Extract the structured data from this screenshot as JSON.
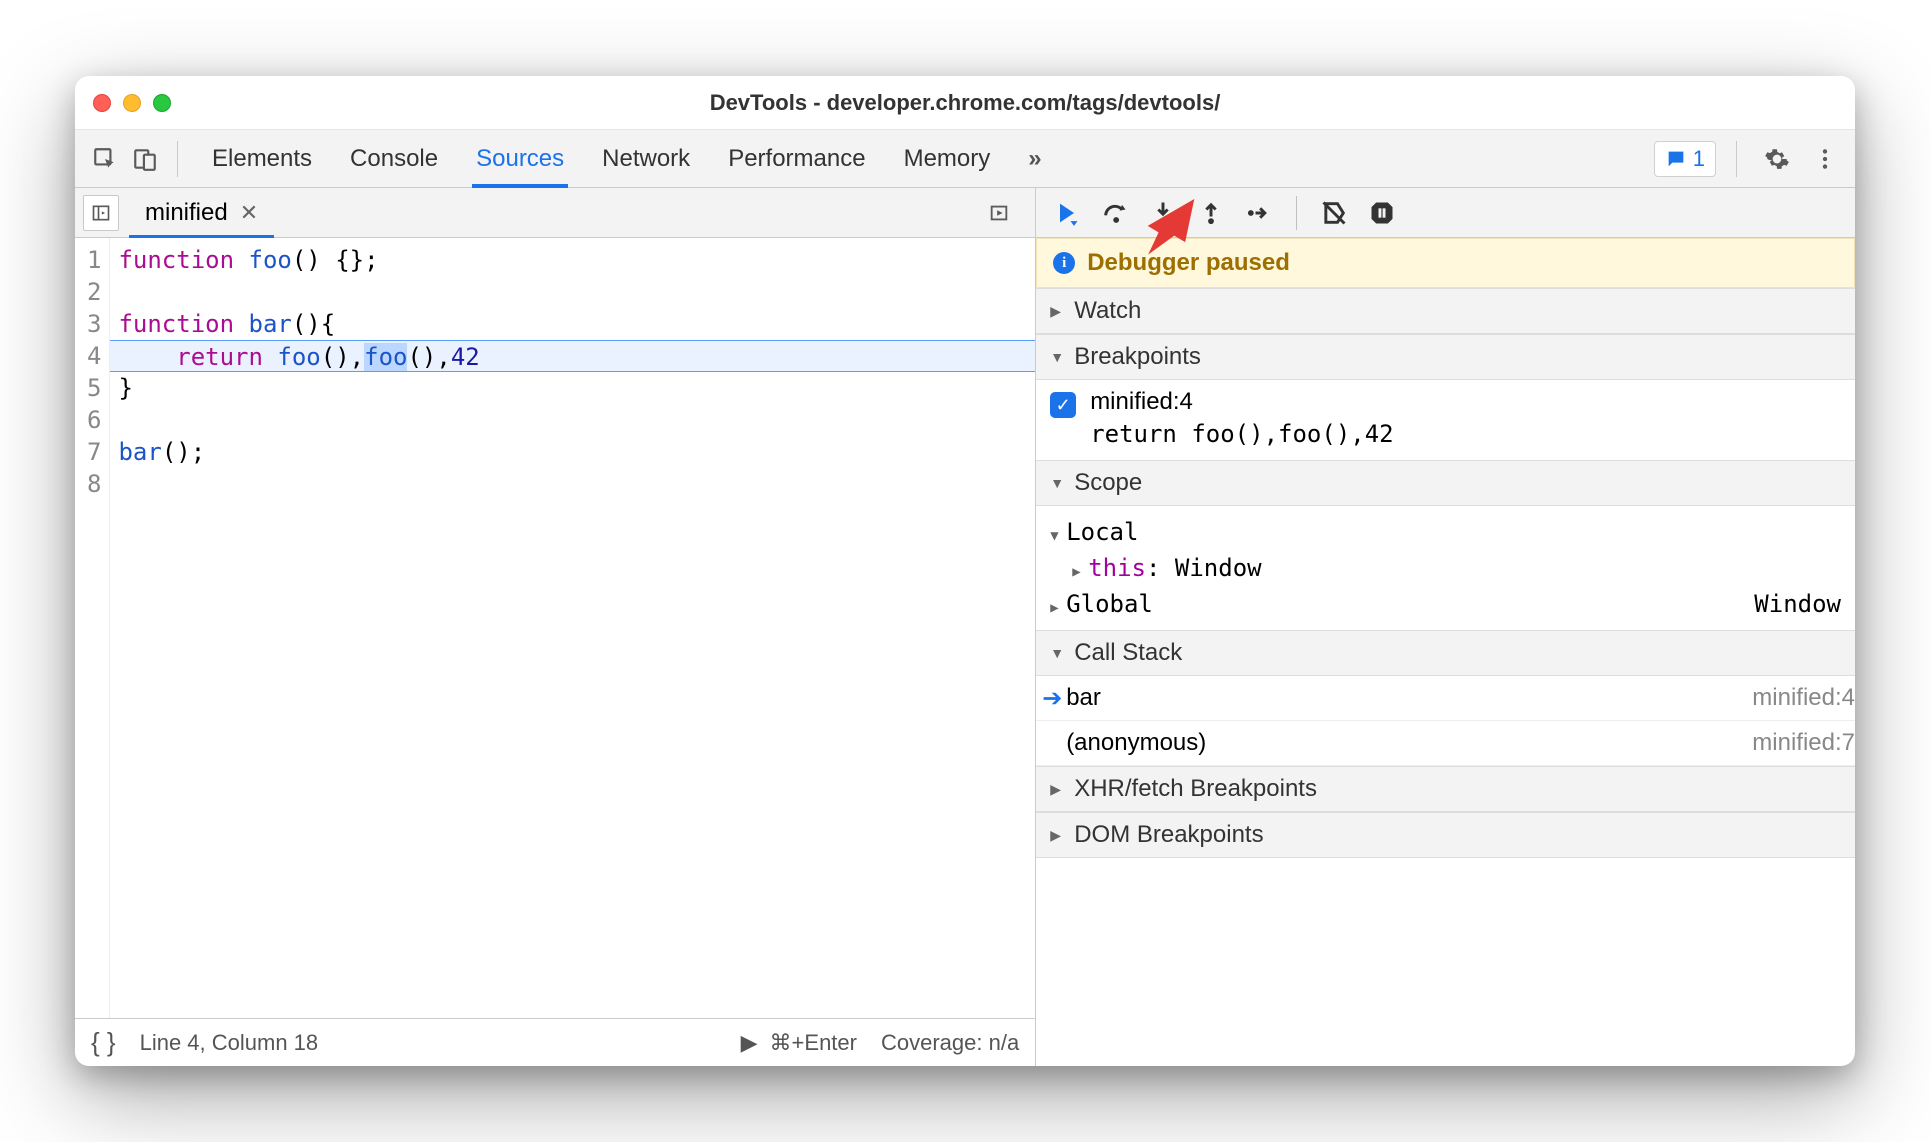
{
  "window": {
    "title": "DevTools - developer.chrome.com/tags/devtools/"
  },
  "top_tabs": {
    "items": [
      "Elements",
      "Console",
      "Sources",
      "Network",
      "Performance",
      "Memory"
    ],
    "active": "Sources",
    "overflow_glyph": "»"
  },
  "issues_badge": {
    "count": "1"
  },
  "source_tab": {
    "name": "minified"
  },
  "editor": {
    "lines": [
      {
        "n": 1,
        "segments": [
          {
            "t": "function ",
            "c": "kw"
          },
          {
            "t": "foo",
            "c": "fn"
          },
          {
            "t": "() {};",
            "c": ""
          }
        ]
      },
      {
        "n": 2,
        "segments": []
      },
      {
        "n": 3,
        "segments": [
          {
            "t": "function ",
            "c": "kw"
          },
          {
            "t": "bar",
            "c": "fn"
          },
          {
            "t": "(){",
            "c": ""
          }
        ]
      },
      {
        "n": 4,
        "hl": true,
        "segments": [
          {
            "t": "    ",
            "c": ""
          },
          {
            "t": "return ",
            "c": "kw"
          },
          {
            "t": "foo",
            "c": "fn"
          },
          {
            "t": "(),",
            "c": ""
          },
          {
            "t": "foo",
            "c": "fn sel"
          },
          {
            "t": "(),",
            "c": ""
          },
          {
            "t": "42",
            "c": "num"
          }
        ]
      },
      {
        "n": 5,
        "segments": [
          {
            "t": "}",
            "c": ""
          }
        ]
      },
      {
        "n": 6,
        "segments": []
      },
      {
        "n": 7,
        "segments": [
          {
            "t": "bar",
            "c": "fn"
          },
          {
            "t": "();",
            "c": ""
          }
        ]
      },
      {
        "n": 8,
        "segments": []
      }
    ]
  },
  "status": {
    "linecol": "Line 4, Column 18",
    "run_hint": "⌘+Enter",
    "coverage": "Coverage: n/a"
  },
  "debugger": {
    "paused_text": "Debugger paused",
    "sections": {
      "watch": "Watch",
      "breakpoints": "Breakpoints",
      "scope": "Scope",
      "call_stack": "Call Stack",
      "xhr": "XHR/fetch Breakpoints",
      "dom": "DOM Breakpoints"
    },
    "breakpoints": [
      {
        "location": "minified:4",
        "code": "return foo(),foo(),42"
      }
    ],
    "scope": {
      "local_label": "Local",
      "this_label": "this",
      "this_value": "Window",
      "global_label": "Global",
      "global_value": "Window"
    },
    "stack": [
      {
        "name": "bar",
        "loc": "minified:4",
        "current": true
      },
      {
        "name": "(anonymous)",
        "loc": "minified:7",
        "current": false
      }
    ]
  },
  "callout": {
    "arrow_target": "step-over-button"
  }
}
